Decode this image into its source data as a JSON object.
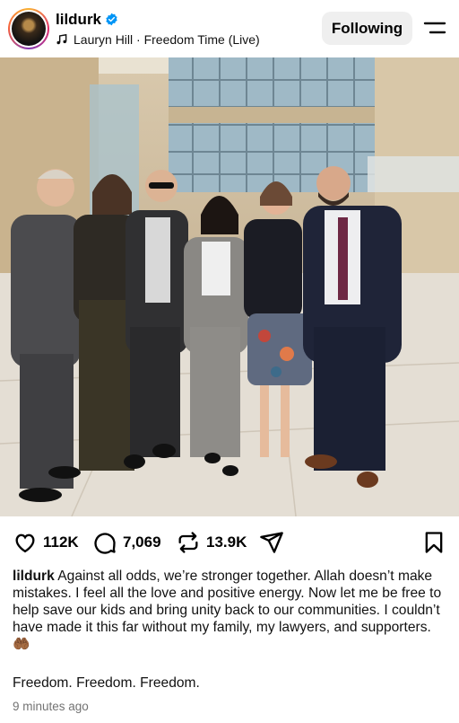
{
  "header": {
    "username": "lildurk",
    "verified": true,
    "music": "Lauryn Hill · Freedom Time (Live)",
    "follow_label": "Following",
    "icons": [
      "avatar",
      "verified-badge-icon",
      "music-note-icon",
      "menu-icon"
    ]
  },
  "media": {
    "type": "video",
    "muted": true,
    "icons": [
      "muted-speaker-icon"
    ]
  },
  "actions": {
    "likes": "112K",
    "comments": "7,069",
    "reposts": "13.9K",
    "icons": [
      "heart-icon",
      "comment-icon",
      "repost-icon",
      "share-icon",
      "save-bookmark-icon"
    ]
  },
  "caption": {
    "username": "lildurk",
    "text": "Against all odds, we’re stronger together. Allah doesn’t make mistakes. I feel all the love and positive energy. Now let me be free to help save our kids and bring unity back to our communities. I couldn’t have made it this far without my family, my lawyers, and supporters.",
    "emoji": "🤲🏾",
    "line2": "Freedom. Freedom. Freedom.",
    "timestamp": "9 minutes ago"
  },
  "colors": {
    "verified_blue": "#0095f6",
    "follow_bg": "#efefef",
    "timestamp_gray": "#737373"
  }
}
